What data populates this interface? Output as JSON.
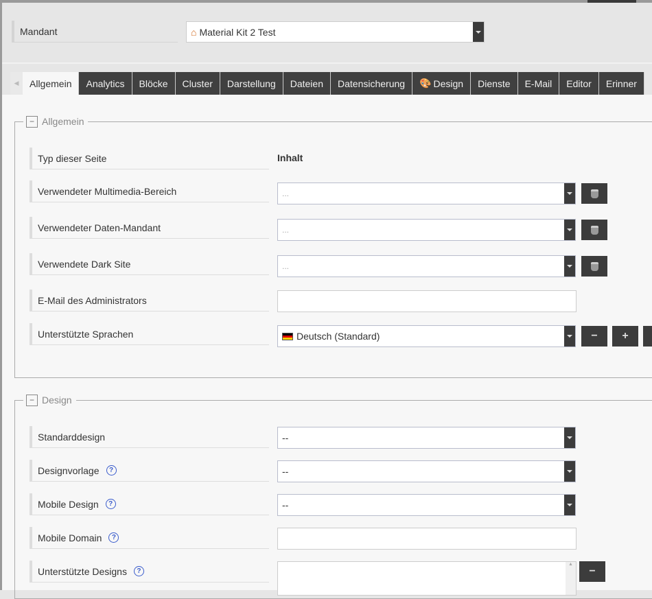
{
  "mandant": {
    "label": "Mandant",
    "value": "Material Kit 2 Test",
    "icon": "home-icon"
  },
  "tabs": [
    {
      "label": "Allgemein",
      "active": true
    },
    {
      "label": "Analytics"
    },
    {
      "label": "Blöcke"
    },
    {
      "label": "Cluster"
    },
    {
      "label": "Darstellung"
    },
    {
      "label": "Dateien"
    },
    {
      "label": "Datensicherung"
    },
    {
      "label": "Design",
      "icon": "palette-icon"
    },
    {
      "label": "Dienste"
    },
    {
      "label": "E-Mail"
    },
    {
      "label": "Editor"
    },
    {
      "label": "Erinner"
    }
  ],
  "allgemein": {
    "title": "Allgemein",
    "typ": {
      "label": "Typ dieser Seite",
      "value": "Inhalt"
    },
    "multimedia": {
      "label": "Verwendeter Multimedia-Bereich",
      "placeholder": "..."
    },
    "daten_mandant": {
      "label": "Verwendeter Daten-Mandant",
      "placeholder": "..."
    },
    "dark_site": {
      "label": "Verwendete Dark Site",
      "placeholder": "..."
    },
    "admin_email": {
      "label": "E-Mail des Administrators",
      "value": ""
    },
    "sprachen": {
      "label": "Unterstützte Sprachen",
      "value": "Deutsch (Standard)",
      "remove": "−",
      "add": "+"
    }
  },
  "design": {
    "title": "Design",
    "standarddesign": {
      "label": "Standarddesign",
      "value": "--"
    },
    "designvorlage": {
      "label": "Designvorlage",
      "value": "--"
    },
    "mobile_design": {
      "label": "Mobile Design",
      "value": "--"
    },
    "mobile_domain": {
      "label": "Mobile Domain",
      "value": ""
    },
    "unterstuetzte_designs": {
      "label": "Unterstützte Designs",
      "remove": "−"
    },
    "help": "?"
  }
}
